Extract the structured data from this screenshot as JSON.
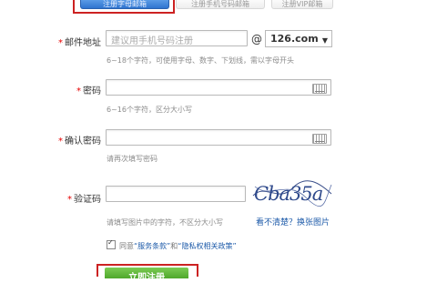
{
  "tabs": [
    {
      "label": "注册字母邮箱"
    },
    {
      "label": "注册手机号码邮箱"
    },
    {
      "label": "注册VIP邮箱"
    }
  ],
  "email": {
    "label": "邮件地址",
    "placeholder": "建议用手机号码注册",
    "at": "@",
    "domain": "126.com",
    "hint": "6~18个字符，可使用字母、数字、下划线，需以字母开头"
  },
  "password": {
    "label": "密码",
    "hint": "6~16个字符，区分大小写"
  },
  "confirm": {
    "label": "确认密码",
    "hint": "请再次填写密码"
  },
  "captcha": {
    "label": "验证码",
    "hint": "请填写图片中的字符，不区分大小写",
    "image_text": "Cba35a",
    "refresh": "看不清楚？换张图片"
  },
  "agree": {
    "prefix": "同意",
    "terms": "“服务条款”",
    "and": "和",
    "privacy": "“隐私权相关政策”"
  },
  "submit": {
    "label": "立即注册"
  },
  "colors": {
    "required": "#e60000",
    "link": "#1c5aa9",
    "tab_active": "#2f74cf",
    "highlight": "#cc2222",
    "submit": "#4ea82b"
  }
}
